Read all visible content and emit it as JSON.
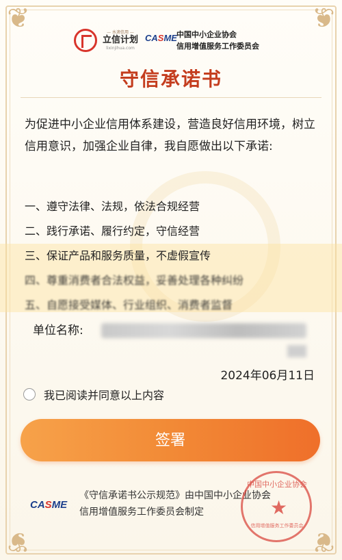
{
  "header": {
    "logo1_tag": "— 水滴信用 —",
    "logo1_name": "立信计划",
    "logo1_url": "lixinjihua.com",
    "casme_logo": "CASME",
    "assoc_line1": "中国中小企业协会",
    "assoc_line2": "信用增值服务工作委员会"
  },
  "title": "守信承诺书",
  "intro": "为促进中小企业信用体系建设，营造良好信用环境，树立信用意识，加强企业自律，我自愿做出以下承诺:",
  "promises": [
    "一、遵守法律、法规，依法合规经营",
    "二、践行承诺、履行约定，守信经营",
    "三、保证产品和服务质量，不虚假宣传",
    "四、尊重消费者合法权益，妥善处理各种纠纷",
    "五、自愿接受媒体、行业组织、消费者监督"
  ],
  "unit_label": "单位名称:",
  "date": "2024年06月11日",
  "agree_label": "我已阅读并同意以上内容",
  "sign_button": "签署",
  "footer": {
    "logo": "CASME",
    "text_line1": "《守信承诺书公示规范》由中国中小企业协会",
    "text_line2": "信用增值服务工作委员会制定"
  },
  "seal": {
    "top_text": "中国中小企业协会",
    "bottom_text": "信用增值服务工作委员会"
  },
  "colors": {
    "title": "#c43d1e",
    "button_start": "#f7a24a",
    "button_end": "#ef6f2a",
    "brand_blue": "#1c3f8c",
    "brand_red": "#d8342b"
  }
}
